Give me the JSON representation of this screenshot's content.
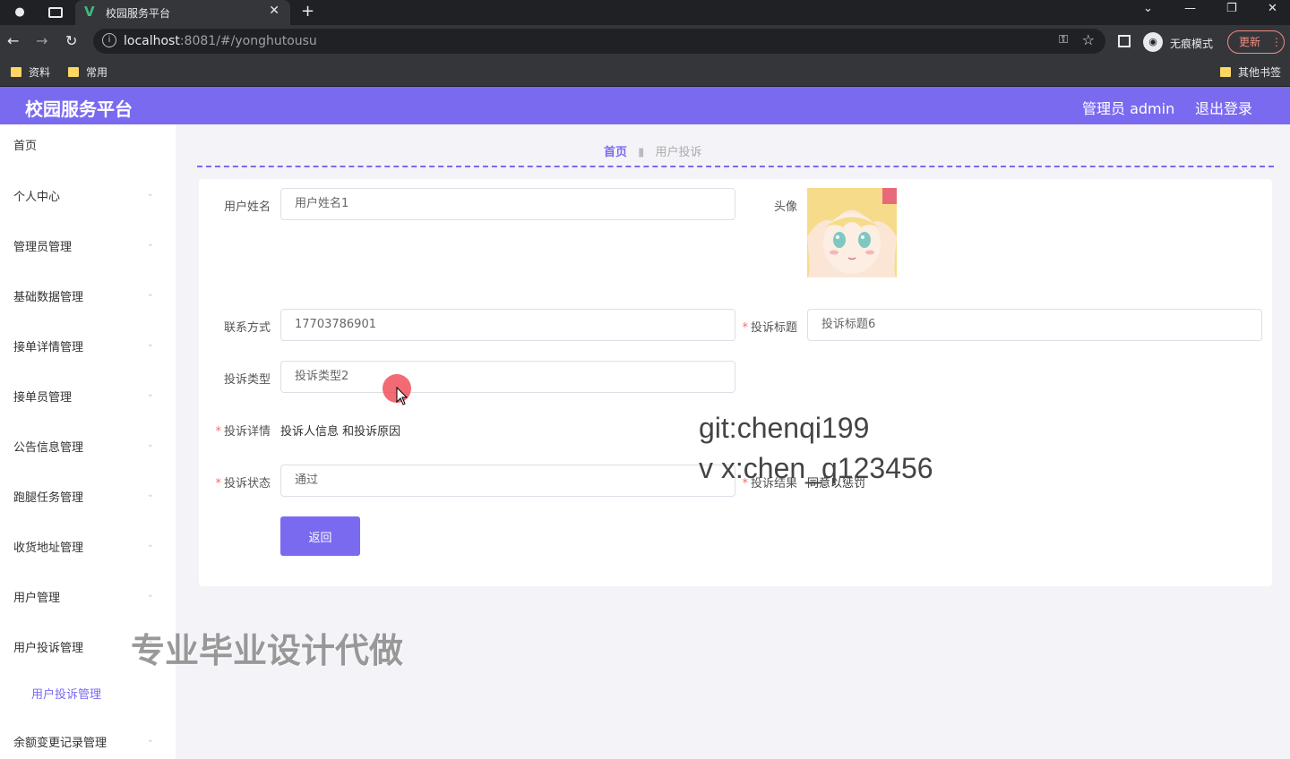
{
  "browser": {
    "tab_title": "校园服务平台",
    "url_host": "localhost",
    "url_rest": ":8081/#/yonghutousu",
    "incognito_label": "无痕模式",
    "update_label": "更新",
    "bookmarks": [
      "资料",
      "常用"
    ],
    "other_bookmarks": "其他书签"
  },
  "header": {
    "title": "校园服务平台",
    "user": "管理员 admin",
    "logout": "退出登录"
  },
  "sidebar": {
    "items": [
      "首页",
      "个人中心",
      "管理员管理",
      "基础数据管理",
      "接单详情管理",
      "接单员管理",
      "公告信息管理",
      "跑腿任务管理",
      "收货地址管理",
      "用户管理",
      "用户投诉管理",
      "余额变更记录管理"
    ],
    "sub_item": "用户投诉管理"
  },
  "breadcrumb": {
    "home": "首页",
    "current": "用户投诉"
  },
  "form": {
    "name_label": "用户姓名",
    "name_value": "用户姓名1",
    "avatar_label": "头像",
    "phone_label": "联系方式",
    "phone_value": "17703786901",
    "title_label": "投诉标题",
    "title_value": "投诉标题6",
    "type_label": "投诉类型",
    "type_value": "投诉类型2",
    "detail_label": "投诉详情",
    "detail_value": "投诉人信息 和投诉原因",
    "status_label": "投诉状态",
    "status_value": "通过",
    "result_label": "投诉结果",
    "result_value": "同意以惩罚",
    "required_mark": "*",
    "back_button": "返回"
  },
  "watermarks": {
    "git": "git:chenqi199",
    "vx": "v x:chen_q123456",
    "ad": "专业毕业设计代做"
  }
}
